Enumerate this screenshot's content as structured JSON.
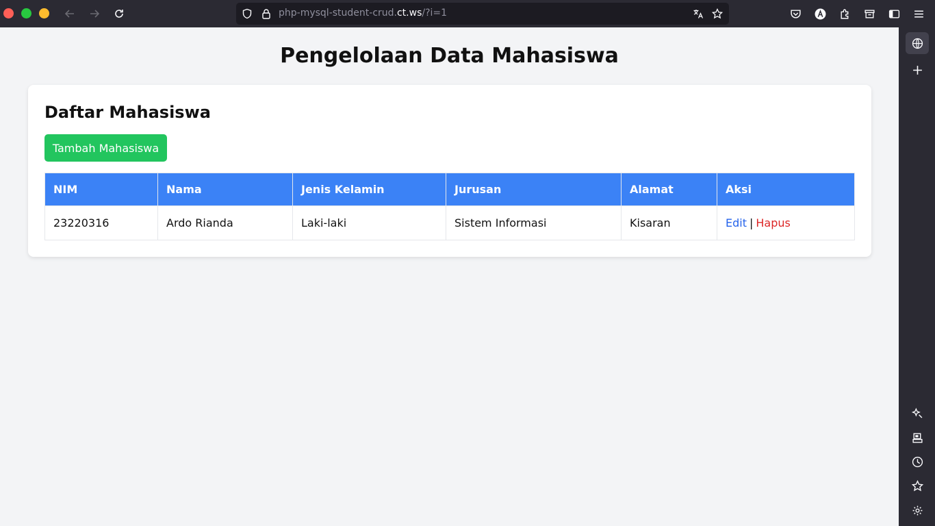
{
  "browser": {
    "url_prefix": "php-mysql-student-crud.",
    "url_host": "ct.ws",
    "url_path": "/?i=1",
    "colors": {
      "toolbar": "#2b2a33",
      "urlbar": "#1c1b22"
    }
  },
  "page": {
    "title": "Pengelolaan Data Mahasiswa",
    "card_title": "Daftar Mahasiswa",
    "add_button": "Tambah Mahasiswa",
    "table": {
      "headers": [
        "NIM",
        "Nama",
        "Jenis Kelamin",
        "Jurusan",
        "Alamat",
        "Aksi"
      ],
      "rows": [
        {
          "nim": "23220316",
          "nama": "Ardo Rianda",
          "jenis_kelamin": "Laki-laki",
          "jurusan": "Sistem Informasi",
          "alamat": "Kisaran",
          "edit": "Edit",
          "separator": "|",
          "delete": "Hapus"
        }
      ]
    },
    "colors": {
      "header_bg": "#3b82f6",
      "button_bg": "#22c55e",
      "edit_link": "#2563eb",
      "delete_link": "#dc2626"
    }
  }
}
